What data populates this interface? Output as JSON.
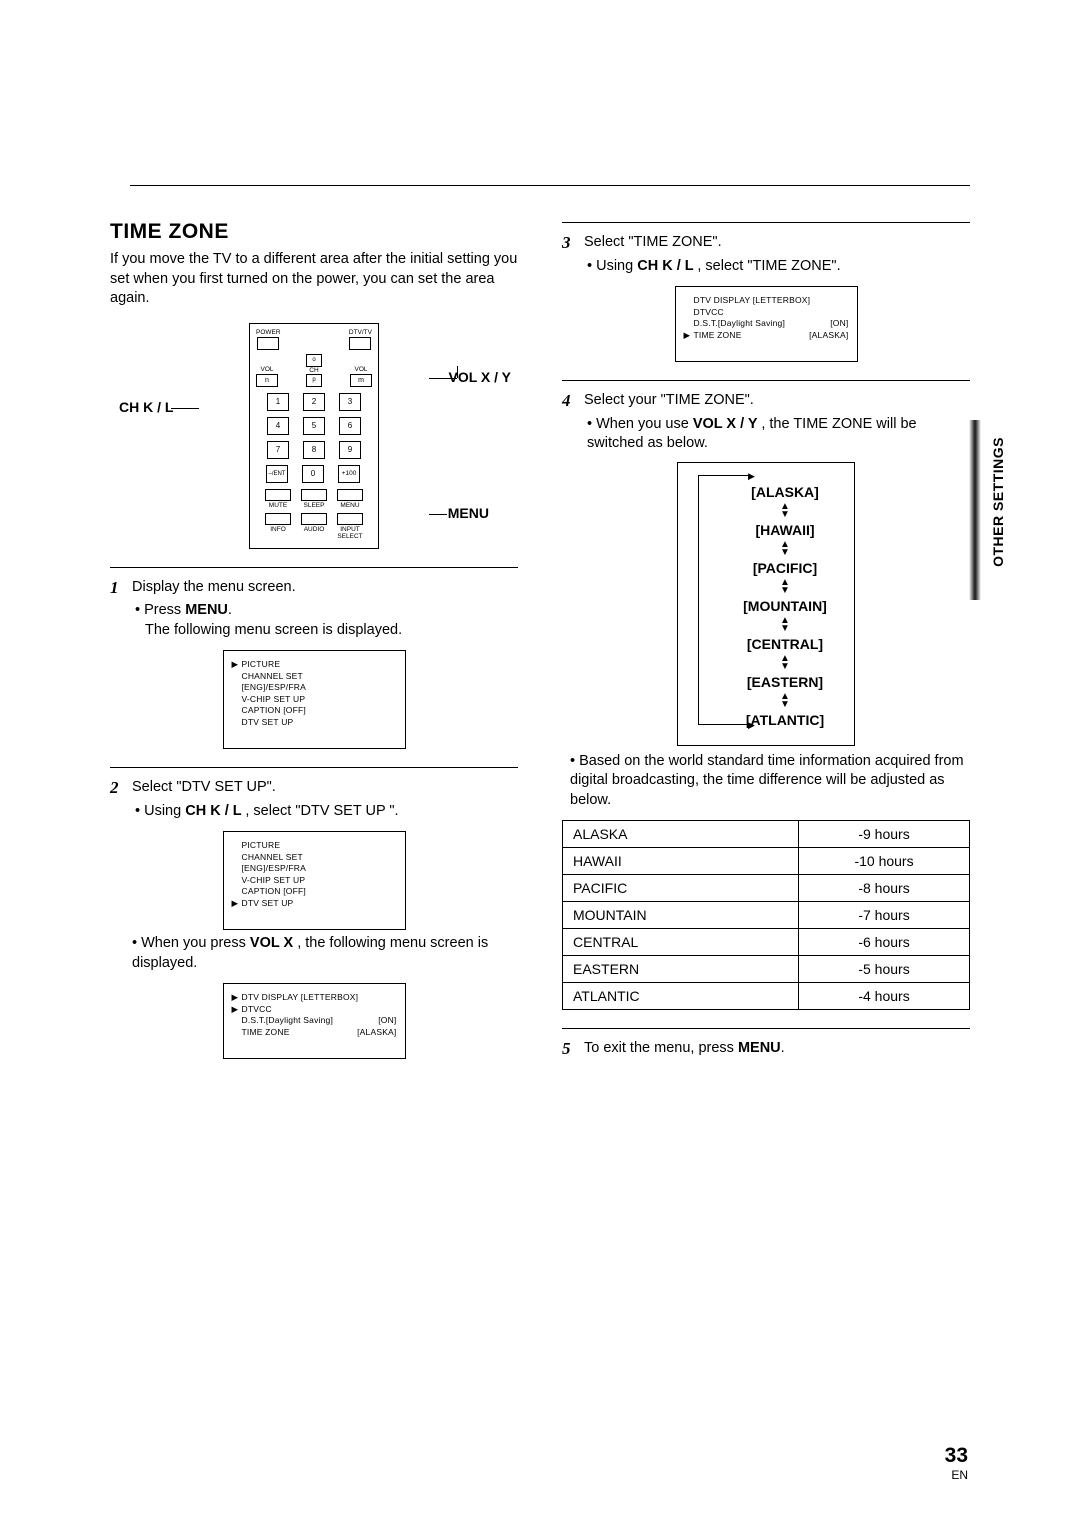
{
  "title": "TIME ZONE",
  "intro": "If you move the TV to a different area after the initial setting you set when you first turned on the power, you can set the area again.",
  "remote": {
    "vol_label": "VOL X / Y",
    "ch_label": "CH K / L",
    "menu_label": "MENU",
    "top": {
      "power": "POWER",
      "dtv": "DTV/TV"
    },
    "vol_l": "VOL",
    "vol_r": "VOL",
    "ch": "CH",
    "nums": [
      "1",
      "2",
      "3",
      "4",
      "5",
      "6",
      "7",
      "8",
      "9"
    ],
    "ent": "–/ENT",
    "zero": "0",
    "p100": "+100",
    "row_a": [
      "MUTE",
      "SLEEP",
      "MENU"
    ],
    "row_b": [
      "INFO",
      "AUDIO",
      "INPUT\nSELECT"
    ]
  },
  "steps": {
    "s1": {
      "n": "1",
      "t": "Display the menu screen.",
      "b1_pre": "• Press ",
      "b1_bold": "MENU",
      "b1_post": ".",
      "b2": "The following menu screen is displayed."
    },
    "s2": {
      "n": "2",
      "t": "Select \"DTV SET UP\".",
      "b1_pre": "• Using ",
      "b1_bold": "CH K / L ",
      "b1_post": ", select \"DTV SET UP \".",
      "b2_pre": "• When you press ",
      "b2_bold": "VOL X ",
      "b2_post": ", the following menu screen is displayed."
    },
    "s3": {
      "n": "3",
      "t": "Select \"TIME ZONE\".",
      "b1_pre": "• Using ",
      "b1_bold": "CH K / L ",
      "b1_post": ", select \"TIME ZONE\"."
    },
    "s4": {
      "n": "4",
      "t": "Select your \"TIME ZONE\".",
      "b1_pre": "• When you use ",
      "b1_bold": "VOL X / Y ",
      "b1_post": ", the TIME ZONE will be switched as below.",
      "note": "• Based on the world standard time information acquired from digital broadcasting, the time difference will be adjusted as below."
    },
    "s5": {
      "n": "5",
      "t_pre": "To exit the menu, press ",
      "t_bold": "MENU",
      "t_post": "."
    }
  },
  "osd1": {
    "rows": [
      {
        "p": "G",
        "l": "PICTURE"
      },
      {
        "p": "",
        "l": "CHANNEL SET"
      },
      {
        "p": "",
        "l": "[ENG]/ESP/FRA"
      },
      {
        "p": "",
        "l": "V-CHIP SET UP"
      },
      {
        "p": "",
        "l": "CAPTION [OFF]"
      },
      {
        "p": "",
        "l": "DTV SET UP"
      }
    ]
  },
  "osd2": {
    "rows": [
      {
        "p": "",
        "l": "PICTURE"
      },
      {
        "p": "",
        "l": "CHANNEL SET"
      },
      {
        "p": "",
        "l": "[ENG]/ESP/FRA"
      },
      {
        "p": "",
        "l": "V-CHIP SET UP"
      },
      {
        "p": "",
        "l": "CAPTION [OFF]"
      },
      {
        "p": "G",
        "l": "DTV SET UP"
      }
    ]
  },
  "osd3": {
    "rows": [
      {
        "p": "G",
        "l": "DTV DISPLAY [LETTERBOX]"
      },
      {
        "p": "G",
        "l": "DTVCC"
      },
      {
        "p": "",
        "l": "D.S.T.[Daylight Saving]",
        "v": "[ON]"
      },
      {
        "p": "",
        "l": "TIME ZONE",
        "v": "[ALASKA]"
      }
    ]
  },
  "osd4": {
    "rows": [
      {
        "p": "",
        "l": "DTV DISPLAY [LETTERBOX]"
      },
      {
        "p": "",
        "l": "DTVCC"
      },
      {
        "p": "",
        "l": "D.S.T.[Daylight Saving]",
        "v": "[ON]"
      },
      {
        "p": "G",
        "l": "TIME ZONE",
        "v": "[ALASKA]"
      }
    ]
  },
  "tz_flow": [
    "[ALASKA]",
    "[HAWAII]",
    "[PACIFIC]",
    "[MOUNTAIN]",
    "[CENTRAL]",
    "[EASTERN]",
    "[ATLANTIC]"
  ],
  "offsets": [
    {
      "z": "ALASKA",
      "h": "-9 hours"
    },
    {
      "z": "HAWAII",
      "h": "-10 hours"
    },
    {
      "z": "PACIFIC",
      "h": "-8 hours"
    },
    {
      "z": "MOUNTAIN",
      "h": "-7 hours"
    },
    {
      "z": "CENTRAL",
      "h": "-6 hours"
    },
    {
      "z": "EASTERN",
      "h": "-5 hours"
    },
    {
      "z": "ATLANTIC",
      "h": "-4 hours"
    }
  ],
  "side_tab": "OTHER SETTINGS",
  "page_num": "33",
  "page_lang": "EN"
}
